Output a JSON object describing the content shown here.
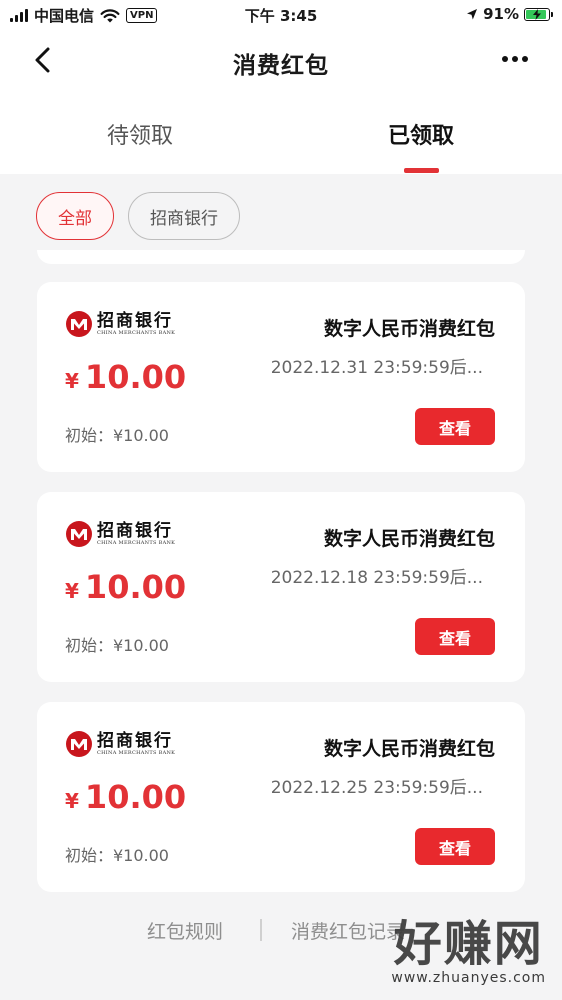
{
  "status_bar": {
    "carrier": "中国电信",
    "vpn": "VPN",
    "time": "下午 3:45",
    "battery": "91%",
    "icons": [
      "signal-icon",
      "wifi-icon",
      "location-arrow-icon",
      "battery-charging-icon"
    ]
  },
  "nav": {
    "title": "消费红包",
    "back_icon": "chevron-left-icon",
    "more_icon": "more-dots-icon"
  },
  "tabs": [
    {
      "label": "待领取",
      "active": false
    },
    {
      "label": "已领取",
      "active": true
    }
  ],
  "filters": [
    {
      "label": "全部",
      "selected": true
    },
    {
      "label": "招商银行",
      "selected": false
    }
  ],
  "cards": [
    {
      "bank_cn": "招商银行",
      "bank_en": "CHINA MERCHANTS BANK",
      "currency": "¥",
      "amount": "10.00",
      "initial": "初始：¥10.00",
      "title": "数字人民币消费红包",
      "expiry": "2022.12.31 23:59:59后...",
      "button": "查看"
    },
    {
      "bank_cn": "招商银行",
      "bank_en": "CHINA MERCHANTS BANK",
      "currency": "¥",
      "amount": "10.00",
      "initial": "初始：¥10.00",
      "title": "数字人民币消费红包",
      "expiry": "2022.12.18 23:59:59后...",
      "button": "查看"
    },
    {
      "bank_cn": "招商银行",
      "bank_en": "CHINA MERCHANTS BANK",
      "currency": "¥",
      "amount": "10.00",
      "initial": "初始：¥10.00",
      "title": "数字人民币消费红包",
      "expiry": "2022.12.25 23:59:59后...",
      "button": "查看"
    }
  ],
  "footer": {
    "rules": "红包规则",
    "records": "消费红包记录"
  },
  "watermark": {
    "big": "好赚网",
    "small": "www.zhuanyes.com"
  },
  "colors": {
    "accent": "#e23236",
    "button": "#e8292d",
    "background": "#f4f4f5"
  }
}
